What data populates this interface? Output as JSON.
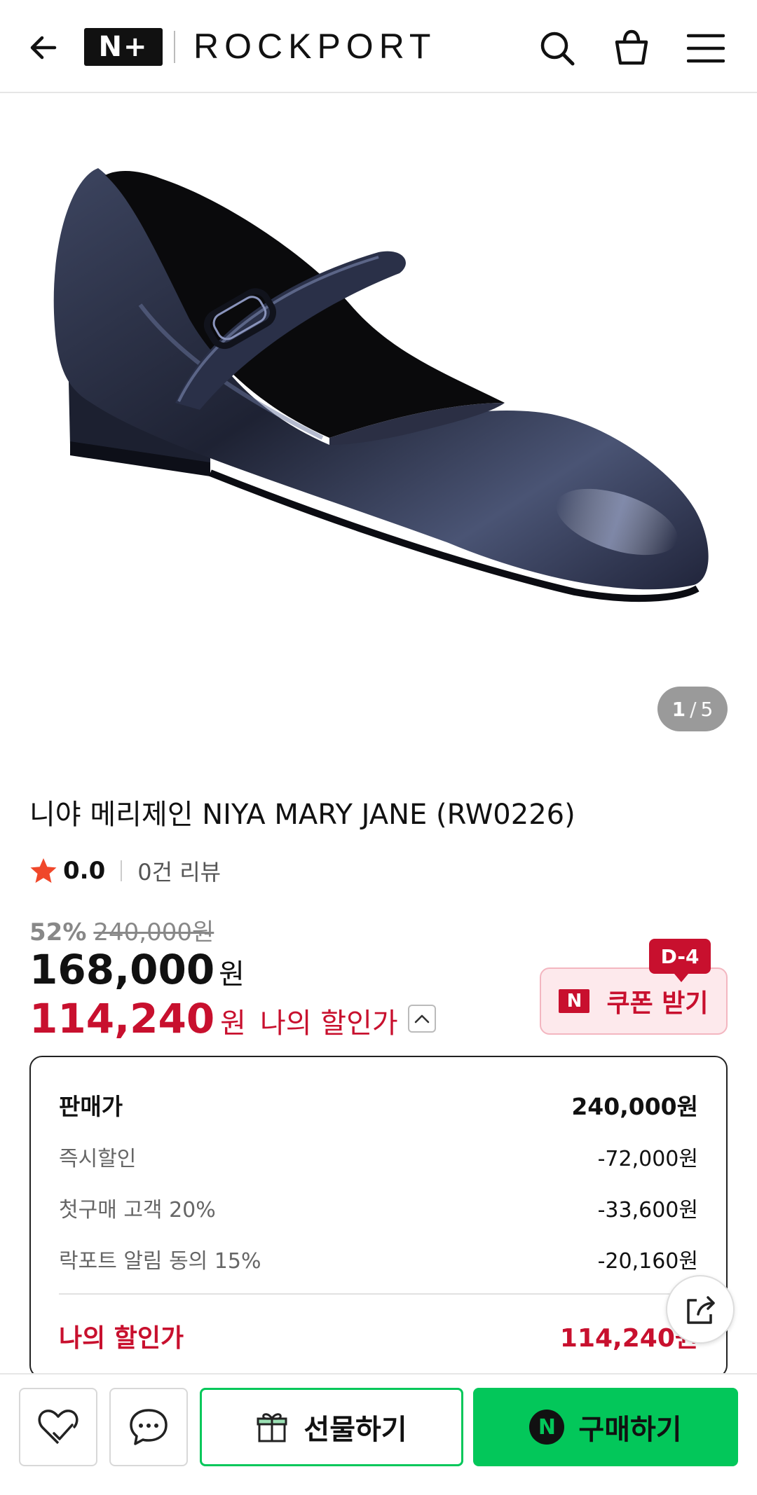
{
  "header": {
    "logo_np": "N+",
    "brand": "ROCKPORT"
  },
  "gallery": {
    "current": "1",
    "sep": "/",
    "total": "5"
  },
  "product": {
    "title": "니야 메리제인 NIYA MARY JANE (RW0226)",
    "rating": "0.0",
    "review_count": "0건 리뷰",
    "discount_pct": "52%",
    "original_price": "240,000원",
    "price": "168,000",
    "currency": "원",
    "my_price": "114,240",
    "my_price_label": "나의 할인가"
  },
  "coupon": {
    "dday": "D-4",
    "badge": "N",
    "label": "쿠폰 받기"
  },
  "breakdown": {
    "rows": [
      {
        "label": "판매가",
        "value": "240,000원"
      },
      {
        "label": "즉시할인",
        "value": "-72,000원"
      },
      {
        "label": "첫구매 고객 20%",
        "value": "-33,600원"
      },
      {
        "label": "락포트 알림 동의 15%",
        "value": "-20,160원"
      }
    ],
    "total_label": "나의 할인가",
    "total_value": "114,240원"
  },
  "bottom_bar": {
    "gift_label": "선물하기",
    "buy_badge": "N",
    "buy_label": "구매하기"
  },
  "colors": {
    "accent_red": "#c8102e",
    "naver_green": "#03c75a"
  }
}
